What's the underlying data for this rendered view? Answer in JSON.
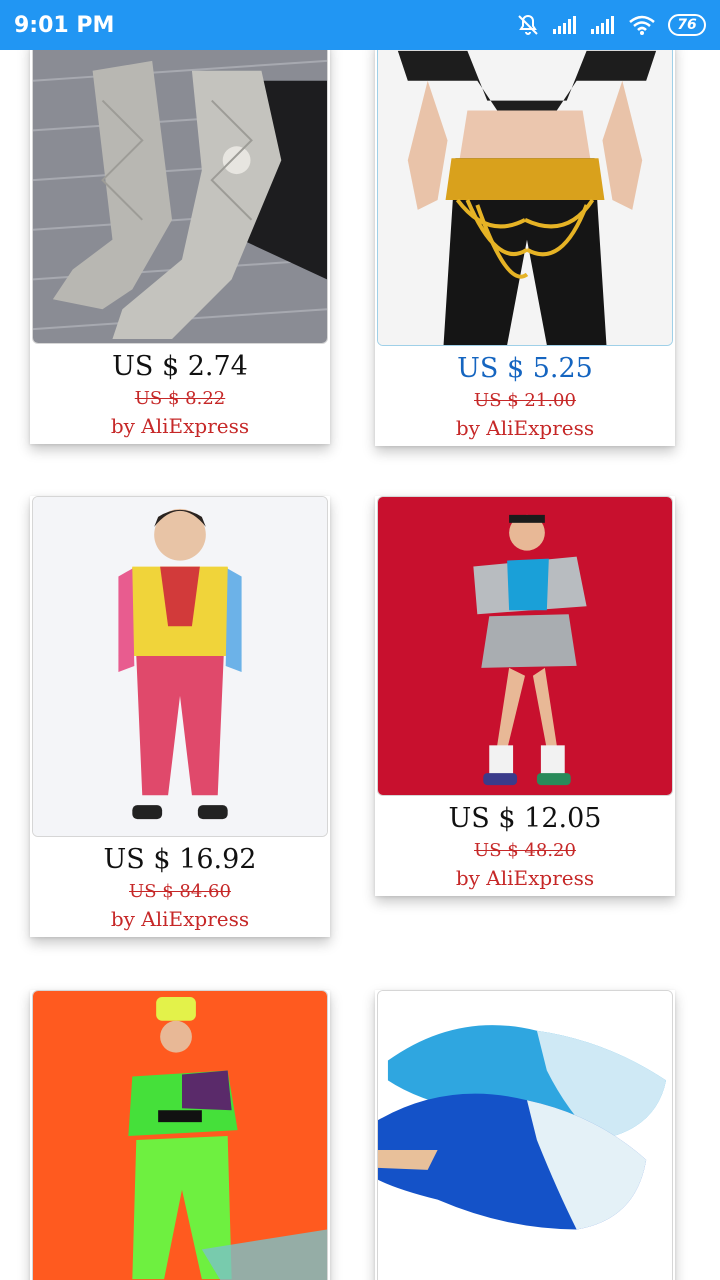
{
  "status_bar": {
    "time": "9:01 PM",
    "battery": "76",
    "icons": [
      "mute-bell-icon",
      "signal-icon",
      "signal-icon",
      "wifi-icon",
      "battery-icon"
    ]
  },
  "products": [
    {
      "price": "US $ 2.74",
      "old_price": "US $ 8.22",
      "seller": "by AliExpress",
      "image": "knit-knee-socks"
    },
    {
      "price": "US $ 5.25",
      "old_price": "US $ 21.00",
      "seller": "by AliExpress",
      "image": "belly-dance-hip-scarf"
    },
    {
      "price": "US $ 16.92",
      "old_price": "US $ 84.60",
      "seller": "by AliExpress",
      "image": "boy-dance-costume"
    },
    {
      "price": "US $ 12.05",
      "old_price": "US $ 48.20",
      "seller": "by AliExpress",
      "image": "girl-silver-jacket-outfit"
    },
    {
      "price": "",
      "old_price": "",
      "seller": "",
      "image": "girl-neon-hiphop-outfit"
    },
    {
      "price": "",
      "old_price": "",
      "seller": "",
      "image": "silk-dance-fan-veils"
    }
  ],
  "colors": {
    "status_bar": "#2196f3",
    "price_highlight": "#1565c0",
    "discount_red": "#c62828"
  }
}
